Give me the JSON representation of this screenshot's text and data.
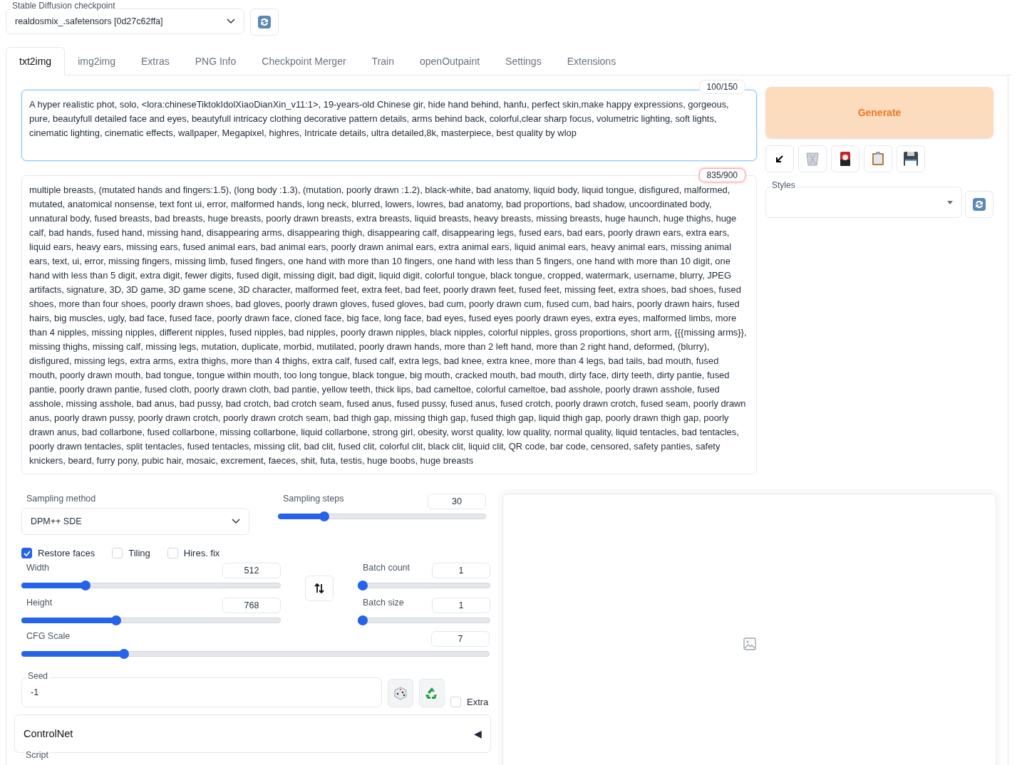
{
  "checkpoint": {
    "label": "Stable Diffusion checkpoint",
    "value": "realdosmix_.safetensors [0d27c62ffa]"
  },
  "tabs": [
    {
      "label": "txt2img",
      "selected": true
    },
    {
      "label": "img2img",
      "selected": false
    },
    {
      "label": "Extras",
      "selected": false
    },
    {
      "label": "PNG Info",
      "selected": false
    },
    {
      "label": "Checkpoint Merger",
      "selected": false
    },
    {
      "label": "Train",
      "selected": false
    },
    {
      "label": "openOutpaint",
      "selected": false
    },
    {
      "label": "Settings",
      "selected": false
    },
    {
      "label": "Extensions",
      "selected": false
    }
  ],
  "prompt": {
    "counter": "100/150",
    "value": "A hyper realistic phot, solo, <lora:chineseTiktokIdolXiaoDianXin_v11:1>, 19-years-old Chinese gir, hide hand behind, hanfu, perfect skin,make happy expressions, gorgeous, pure, beautyfull detailed face and eyes, beautyfull intricacy clothing decorative pattern details, arms behind back, colorful,clear sharp focus, volumetric lighting, soft lights, cinematic lighting, cinematic effects, wallpaper, Megapixel, highres, Intricate details,  ultra detailed,8k, masterpiece, best quality by wlop"
  },
  "negative_prompt": {
    "counter": "835/900",
    "value": "multiple breasts, (mutated hands and fingers:1.5), (long body :1.3), (mutation, poorly drawn :1.2), black-white, bad anatomy, liquid body, liquid tongue, disfigured, malformed, mutated, anatomical nonsense, text font ui, error, malformed hands, long neck, blurred, lowers, lowres, bad anatomy, bad proportions, bad shadow, uncoordinated body, unnatural body, fused breasts, bad breasts, huge breasts, poorly drawn breasts, extra breasts, liquid breasts, heavy breasts, missing breasts, huge haunch, huge thighs, huge calf, bad hands, fused hand, missing hand, disappearing arms, disappearing thigh, disappearing calf, disappearing legs, fused ears, bad ears, poorly drawn ears, extra ears, liquid ears, heavy ears, missing ears, fused animal ears, bad animal ears, poorly drawn animal ears, extra animal ears, liquid animal ears, heavy animal ears, missing animal ears, text, ui, error, missing fingers, missing limb, fused fingers, one hand with more than 10 fingers, one hand with less than 5 fingers, one hand with more than 10 digit, one hand with less than 5 digit, extra digit, fewer digits, fused digit, missing digit, bad digit, liquid digit, colorful tongue, black tongue, cropped, watermark, username, blurry, JPEG artifacts, signature, 3D, 3D game, 3D game scene, 3D character, malformed feet, extra feet, bad feet, poorly drawn feet, fused feet, missing feet, extra shoes, bad shoes, fused shoes, more than four shoes, poorly drawn shoes, bad gloves, poorly drawn gloves, fused gloves, bad cum, poorly drawn cum, fused cum, bad hairs, poorly drawn hairs, fused hairs, big muscles, ugly, bad face, fused face, poorly drawn face, cloned face, big face, long face, bad eyes, fused eyes poorly drawn eyes, extra eyes, malformed limbs, more than 4 nipples, missing nipples, different nipples, fused nipples, bad nipples, poorly drawn nipples, black nipples, colorful nipples, gross proportions, short arm, {{{missing arms}}, missing thighs, missing calf, missing legs, mutation, duplicate, morbid, mutilated, poorly drawn hands, more than 2 left hand, more than 2 right hand, deformed, (blurry), disfigured, missing legs, extra arms, extra thighs, more than 4 thighs, extra calf, fused calf, extra legs, bad knee, extra knee, more than 4 legs, bad tails, bad mouth, fused mouth, poorly drawn mouth, bad tongue, tongue within mouth, too long tongue, black tongue, big mouth, cracked mouth, bad mouth, dirty face, dirty teeth, dirty pantie, fused pantie, poorly drawn pantie, fused cloth, poorly drawn cloth, bad pantie, yellow teeth, thick lips, bad cameltoe, colorful cameltoe, bad asshole, poorly drawn asshole, fused asshole, missing asshole, bad anus, bad pussy, bad crotch, bad crotch seam, fused anus, fused pussy, fused anus, fused crotch, poorly drawn crotch, fused seam, poorly drawn anus, poorly drawn pussy, poorly drawn crotch, poorly drawn crotch seam, bad thigh gap, missing thigh gap, fused thigh gap, liquid thigh gap, poorly drawn thigh gap, poorly drawn anus, bad collarbone, fused collarbone, missing collarbone, liquid collarbone, strong girl, obesity, worst quality, low quality, normal quality, liquid tentacles, bad tentacles, poorly drawn tentacles, split tentacles, fused tentacles, missing clit, bad clit, fused clit, colorful clit, black clit, liquid clit, QR code, bar code, censored, safety panties, safety knickers, beard, furry pony, pubic hair, mosaic, excrement, faeces, shit, futa, testis, huge boobs, huge breasts"
  },
  "generate_button": "Generate",
  "styles": {
    "label": "Styles"
  },
  "sampling_method": {
    "label": "Sampling method",
    "value": "DPM++ SDE"
  },
  "sliders": [
    {
      "label": "Sampling steps",
      "value": "30",
      "level": 0.21
    },
    {
      "label": "Width",
      "value": "512",
      "level": 0.236
    },
    {
      "label": "Batch count",
      "value": "1",
      "level": 0
    },
    {
      "label": "Height",
      "value": "768",
      "level": 0.36
    },
    {
      "label": "Batch size",
      "value": "1",
      "level": 0
    },
    {
      "label": "CFG Scale",
      "value": "7",
      "level": 0.213
    }
  ],
  "checkboxes": [
    {
      "label": "Restore faces",
      "checked": true
    },
    {
      "label": "Tiling",
      "checked": false
    },
    {
      "label": "Hires. fix",
      "checked": false
    }
  ],
  "seed": {
    "label": "Seed",
    "value": "-1",
    "extra": {
      "label": "Extra",
      "checked": false
    }
  },
  "controlnet": {
    "title": "ControlNet",
    "toggle": "◀"
  },
  "script": {
    "label": "Script"
  }
}
